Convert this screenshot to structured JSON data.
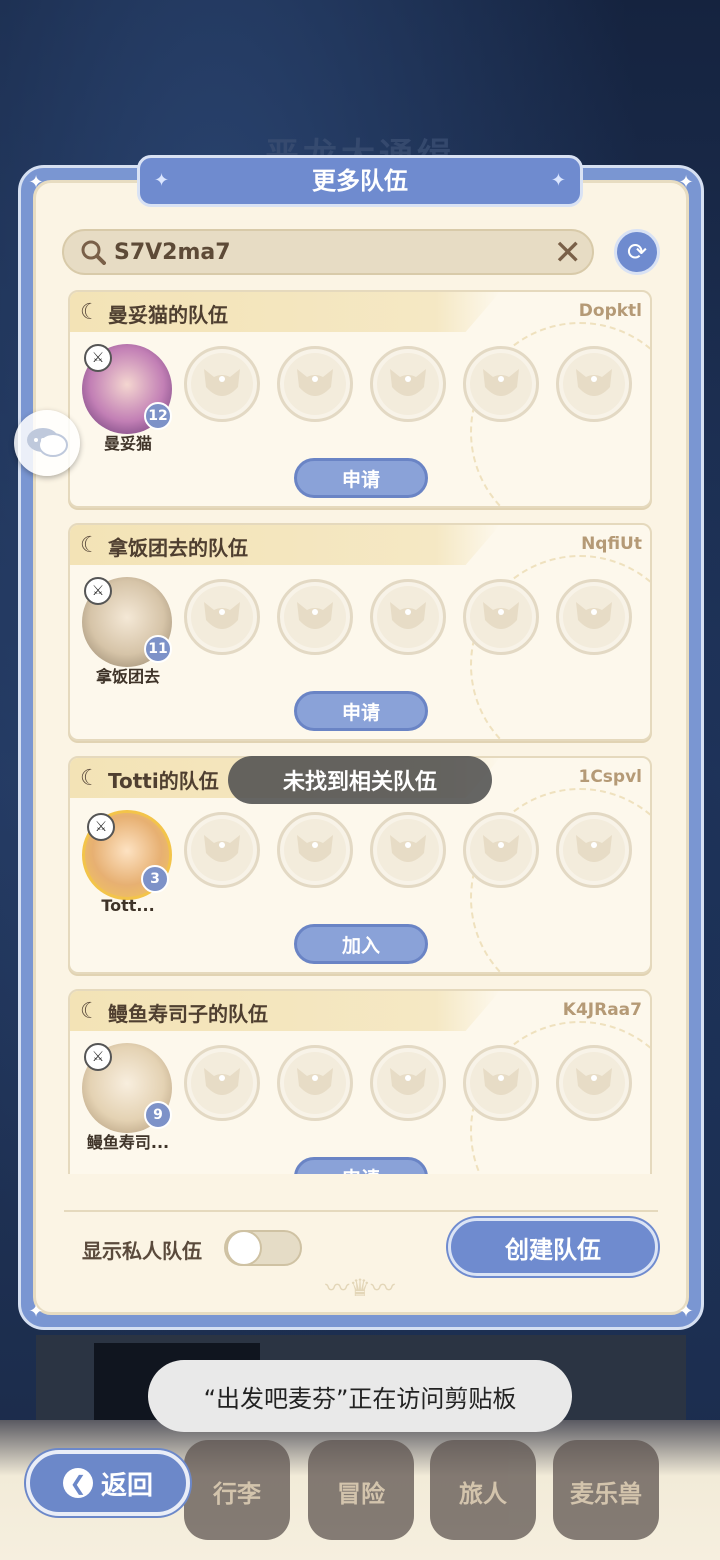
{
  "background": {
    "title": "恶龙大通缉"
  },
  "dialog": {
    "title": "更多队伍",
    "search": {
      "value": "S7V2ma7"
    },
    "teams": [
      {
        "name": "曼妥猫的队伍",
        "code": "Dopktl",
        "leader": "曼妥猫",
        "level": "12",
        "action": "申请"
      },
      {
        "name": "拿饭团去的队伍",
        "code": "NqfiUt",
        "leader": "拿饭团去",
        "level": "11",
        "action": "申请"
      },
      {
        "name": "Totti的队伍",
        "code": "1Cspvl",
        "leader": "Tott...",
        "level": "3",
        "action": "加入"
      },
      {
        "name": "鳗鱼寿司子的队伍",
        "code": "K4JRaa7",
        "leader": "鳗鱼寿司...",
        "level": "9",
        "action": "申请"
      }
    ],
    "not_found_toast": "未找到相关队伍",
    "show_private_label": "显示私人队伍",
    "show_private_on": false,
    "create_label": "创建队伍"
  },
  "nav": {
    "back_label": "返回",
    "tabs": [
      "行李",
      "冒险",
      "旅人",
      "麦乐兽"
    ]
  },
  "clipboard_toast": "“出发吧麦芬”正在访问剪贴板",
  "colors": {
    "accent": "#6f8bcf",
    "panel": "#fbf4e4"
  }
}
